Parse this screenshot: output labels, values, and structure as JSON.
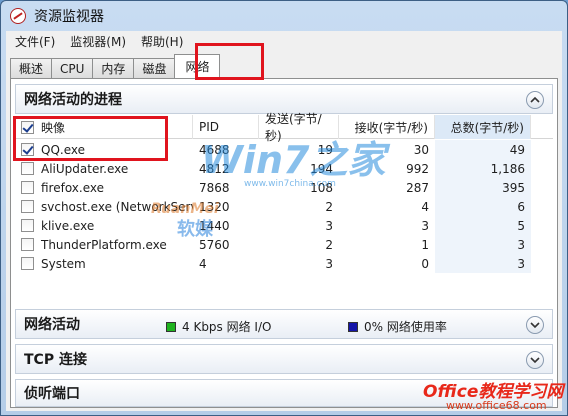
{
  "window": {
    "title": "资源监视器"
  },
  "menu": [
    "文件(F)",
    "监视器(M)",
    "帮助(H)"
  ],
  "tabs": [
    "概述",
    "CPU",
    "内存",
    "磁盘",
    "网络"
  ],
  "active_tab": "网络",
  "processes_section": {
    "title": "网络活动的进程",
    "columns": [
      "映像",
      "PID",
      "发送(字节/秒)",
      "接收(字节/秒)",
      "总数(字节/秒)"
    ],
    "rows": [
      {
        "name": "QQ.exe",
        "pid": "4688",
        "send": "19",
        "recv": "30",
        "total": "49",
        "checked": true
      },
      {
        "name": "AliUpdater.exe",
        "pid": "4812",
        "send": "194",
        "recv": "992",
        "total": "1,186",
        "checked": false
      },
      {
        "name": "firefox.exe",
        "pid": "7868",
        "send": "108",
        "recv": "287",
        "total": "395",
        "checked": false
      },
      {
        "name": "svchost.exe (NetworkService)",
        "pid": "1320",
        "send": "2",
        "recv": "4",
        "total": "6",
        "checked": false
      },
      {
        "name": "klive.exe",
        "pid": "1440",
        "send": "3",
        "recv": "3",
        "total": "5",
        "checked": false
      },
      {
        "name": "ThunderPlatform.exe",
        "pid": "5760",
        "send": "2",
        "recv": "1",
        "total": "3",
        "checked": false
      },
      {
        "name": "System",
        "pid": "4",
        "send": "3",
        "recv": "0",
        "total": "3",
        "checked": false
      }
    ]
  },
  "network_activity": {
    "title": "网络活动",
    "io_text": "4 Kbps 网络 I/O",
    "io_color": "#1fb31f",
    "usage_text": "0% 网络使用率",
    "usage_color": "#1414a8"
  },
  "tcp_section": {
    "title": "TCP 连接"
  },
  "listen_section": {
    "title": "侦听端口"
  },
  "watermarks": {
    "win7_main": "Win7之家",
    "win7_url": "www.win7china.com",
    "ruanmei": "RuanMei",
    "ruanmei_cn": "软媒",
    "office_main": "Office教程学习网",
    "office_url": "www.office68.com"
  }
}
